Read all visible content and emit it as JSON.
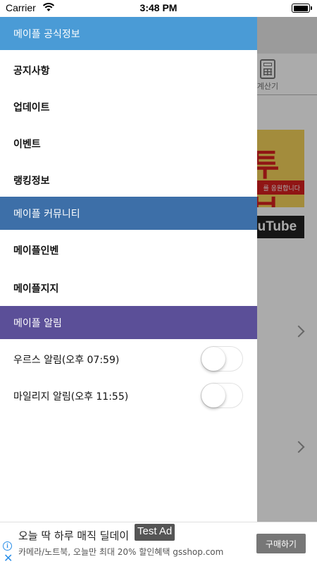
{
  "status_bar": {
    "carrier": "Carrier",
    "time": "3:48 PM",
    "wifi_icon": "wifi-icon",
    "battery_icon": "battery-icon"
  },
  "background": {
    "calculator_label": "계산기",
    "banner_text": "투브",
    "banner_ribbon": "를 응원합니다",
    "youtube_text": "ouTube"
  },
  "drawer": {
    "sections": [
      {
        "title": "메이플 공식정보",
        "color": "#4a9bd6",
        "items": [
          "공지사항",
          "업데이트",
          "이벤트",
          "랭킹정보"
        ]
      },
      {
        "title": "메이플 커뮤니티",
        "color": "#3d6fa8",
        "items": [
          "메이플인벤",
          "메이플지지"
        ]
      },
      {
        "title": "메이플 알림",
        "color": "#5b4f98",
        "toggles": [
          {
            "label": "우르스 알림(오후 07:59)",
            "on": false
          },
          {
            "label": "마일리지 알림(오후 11:55)",
            "on": false
          }
        ]
      }
    ]
  },
  "ad": {
    "title": "오늘 딱 하루 매직 딜데이",
    "label": "Test Ad",
    "subtitle": "카메라/노트북, 오늘만 최대 20% 할인혜택 gsshop.com",
    "button": "구매하기"
  }
}
